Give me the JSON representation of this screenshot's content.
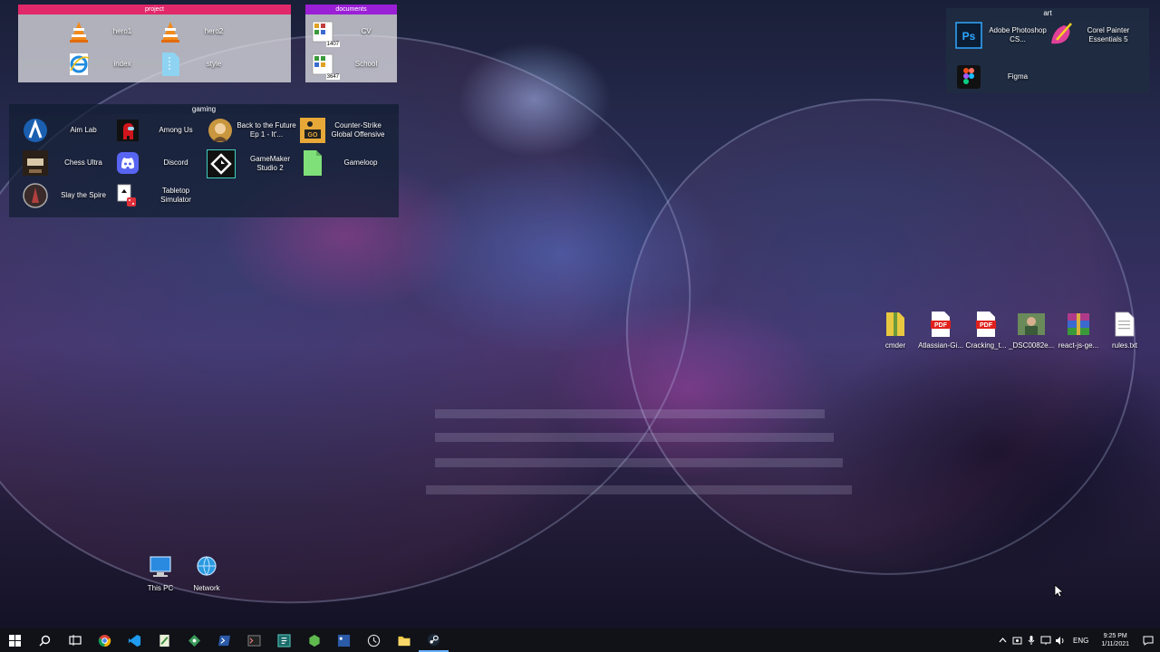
{
  "fences": {
    "project": {
      "title": "project",
      "items": [
        "hero1",
        "hero2",
        "index",
        "style"
      ]
    },
    "documents": {
      "title": "documents",
      "items": [
        "CV",
        "School"
      ],
      "badges": [
        "1407",
        "3647"
      ]
    },
    "art": {
      "title": "art",
      "items": [
        "Adobe Photoshop CS...",
        "Corel Painter Essentials 5",
        "Figma"
      ]
    },
    "gaming": {
      "title": "gaming",
      "items": [
        "Aim Lab",
        "Among Us",
        "Back to the Future Ep 1 - It'...",
        "Counter-Strike Global Offensive",
        "Chess Ultra",
        "Discord",
        "GameMaker Studio 2",
        "Gameloop",
        "Slay the Spire",
        "Tabletop Simulator"
      ]
    }
  },
  "desktop_icons": [
    "cmder",
    "Atlassian-Gi...",
    "Cracking_t...",
    "_DSC0082e...",
    "react-js-ge...",
    "rules.txt"
  ],
  "system_icons": [
    "This PC",
    "Network"
  ],
  "taskbar": {
    "clock_time": "9:25 PM",
    "clock_date": "1/11/2021",
    "language": "ENG"
  },
  "colors": {
    "project_fence": "#e0286a",
    "documents_fence": "#9b1fd6",
    "taskbar": "#101218"
  }
}
